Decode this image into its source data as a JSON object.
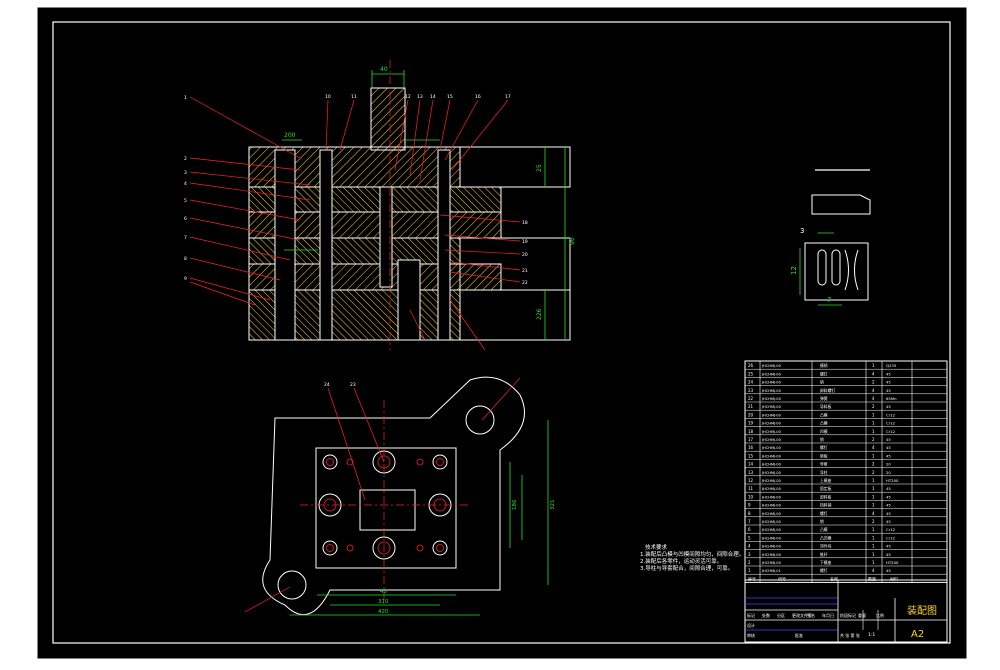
{
  "drawing": {
    "sheet_title": "装配图",
    "sheet_size": "A2",
    "colors": {
      "background": "#000000",
      "frame": "#ffffff",
      "part_outline": "#ffffff",
      "leader": "#ff2020",
      "hatch": "#ffd21f",
      "dimension": "#22e02a",
      "table_text": "#ffffff",
      "title_block_blue": "#3a4dff"
    },
    "part_labels_top_left": [
      "1",
      "2",
      "3",
      "4",
      "5",
      "6",
      "7",
      "8",
      "9"
    ],
    "part_labels_top": [
      "10",
      "11",
      "12",
      "13",
      "14",
      "15",
      "16",
      "17"
    ],
    "part_labels_right": [
      "18",
      "19",
      "20",
      "21",
      "22"
    ],
    "part_labels_bottom": [
      "24",
      "23"
    ],
    "dimensions_front": {
      "top_width": "200",
      "overall_height": "96",
      "left_small": "25",
      "center": "40",
      "lower_height": "226"
    },
    "dimensions_plan": {
      "width1": "420",
      "width2": "310",
      "height1": "321",
      "height2": "186",
      "width3": "40"
    },
    "strip_dimensions": {
      "pitch": "7",
      "width": "3",
      "height": "12"
    },
    "technical_requirements": {
      "heading": "技术要求",
      "lines": [
        "1.装配后凸模与凹模间隙均匀，间隙合理。",
        "2.装配后各零件，运动灵活可靠。",
        "3.导柱与导套配合，间隙合理，可靠。"
      ]
    },
    "bom": {
      "rows": [
        {
          "no": "26",
          "code": "JHCHMJ-00",
          "name": "模柄",
          "qty": "1",
          "mat": "Q235"
        },
        {
          "no": "25",
          "code": "JHCHMJ-00",
          "name": "螺钉",
          "qty": "4",
          "mat": "45"
        },
        {
          "no": "24",
          "code": "JHCHMJ-00",
          "name": "销",
          "qty": "2",
          "mat": "45"
        },
        {
          "no": "23",
          "code": "JHCHMJ-00",
          "name": "卸料螺钉",
          "qty": "4",
          "mat": "45"
        },
        {
          "no": "22",
          "code": "JHCHMJ-00",
          "name": "弹簧",
          "qty": "4",
          "mat": "65Mn"
        },
        {
          "no": "21",
          "code": "JHCHMJ-00",
          "name": "导料板",
          "qty": "2",
          "mat": "45"
        },
        {
          "no": "20",
          "code": "JHCHMJ-00",
          "name": "凸模",
          "qty": "1",
          "mat": "Cr12"
        },
        {
          "no": "19",
          "code": "JHCHMJ-00",
          "name": "凸模",
          "qty": "1",
          "mat": "Cr12"
        },
        {
          "no": "18",
          "code": "JHCHMJ-00",
          "name": "凹模",
          "qty": "1",
          "mat": "Cr12"
        },
        {
          "no": "17",
          "code": "JHCHMJ-00",
          "name": "销",
          "qty": "2",
          "mat": "45"
        },
        {
          "no": "16",
          "code": "JHCHMJ-00",
          "name": "螺钉",
          "qty": "4",
          "mat": "45"
        },
        {
          "no": "15",
          "code": "JHCHMJ-00",
          "name": "垫板",
          "qty": "1",
          "mat": "45"
        },
        {
          "no": "14",
          "code": "JHCHMJ-00",
          "name": "导套",
          "qty": "2",
          "mat": "20"
        },
        {
          "no": "13",
          "code": "JHCHMJ-00",
          "name": "导柱",
          "qty": "2",
          "mat": "20"
        },
        {
          "no": "12",
          "code": "JHCHMJ-00",
          "name": "上模座",
          "qty": "1",
          "mat": "HT200"
        },
        {
          "no": "11",
          "code": "JHCHMJ-00",
          "name": "固定板",
          "qty": "1",
          "mat": "45"
        },
        {
          "no": "10",
          "code": "JHCHMJ-00",
          "name": "卸料板",
          "qty": "1",
          "mat": "45"
        },
        {
          "no": "9",
          "code": "JHCHMJ-00",
          "name": "挡料销",
          "qty": "1",
          "mat": "45"
        },
        {
          "no": "8",
          "code": "JHCHMJ-00",
          "name": "螺钉",
          "qty": "4",
          "mat": "45"
        },
        {
          "no": "7",
          "code": "JHCHMJ-00",
          "name": "销",
          "qty": "2",
          "mat": "45"
        },
        {
          "no": "6",
          "code": "JHCHMJ-00",
          "name": "凸模",
          "qty": "1",
          "mat": "Cr12"
        },
        {
          "no": "5",
          "code": "JHCHMJ-00",
          "name": "凸凹模",
          "qty": "1",
          "mat": "Cr12"
        },
        {
          "no": "4",
          "code": "JHCHMJ-00",
          "name": "顶件块",
          "qty": "1",
          "mat": "45"
        },
        {
          "no": "3",
          "code": "JHCHMJ-00",
          "name": "推杆",
          "qty": "1",
          "mat": "45"
        },
        {
          "no": "2",
          "code": "JHCHMJ-00",
          "name": "下模座",
          "qty": "1",
          "mat": "HT200"
        },
        {
          "no": "1",
          "code": "JHCHMJ-01",
          "name": "螺钉",
          "qty": "4",
          "mat": "45"
        }
      ],
      "header": {
        "no": "序号",
        "code": "代号",
        "name": "名称",
        "qty": "数量",
        "mat": "材料"
      }
    },
    "title_block": {
      "labels": [
        "标记",
        "处数",
        "分区",
        "更改文件号",
        "签名",
        "年月日"
      ],
      "stage_labels": [
        "阶段标记",
        "重量",
        "比例"
      ],
      "scale": "1:1",
      "design": "设计",
      "check": "审核",
      "approve": "批准",
      "sheet_note": "共 张 第 张"
    }
  }
}
